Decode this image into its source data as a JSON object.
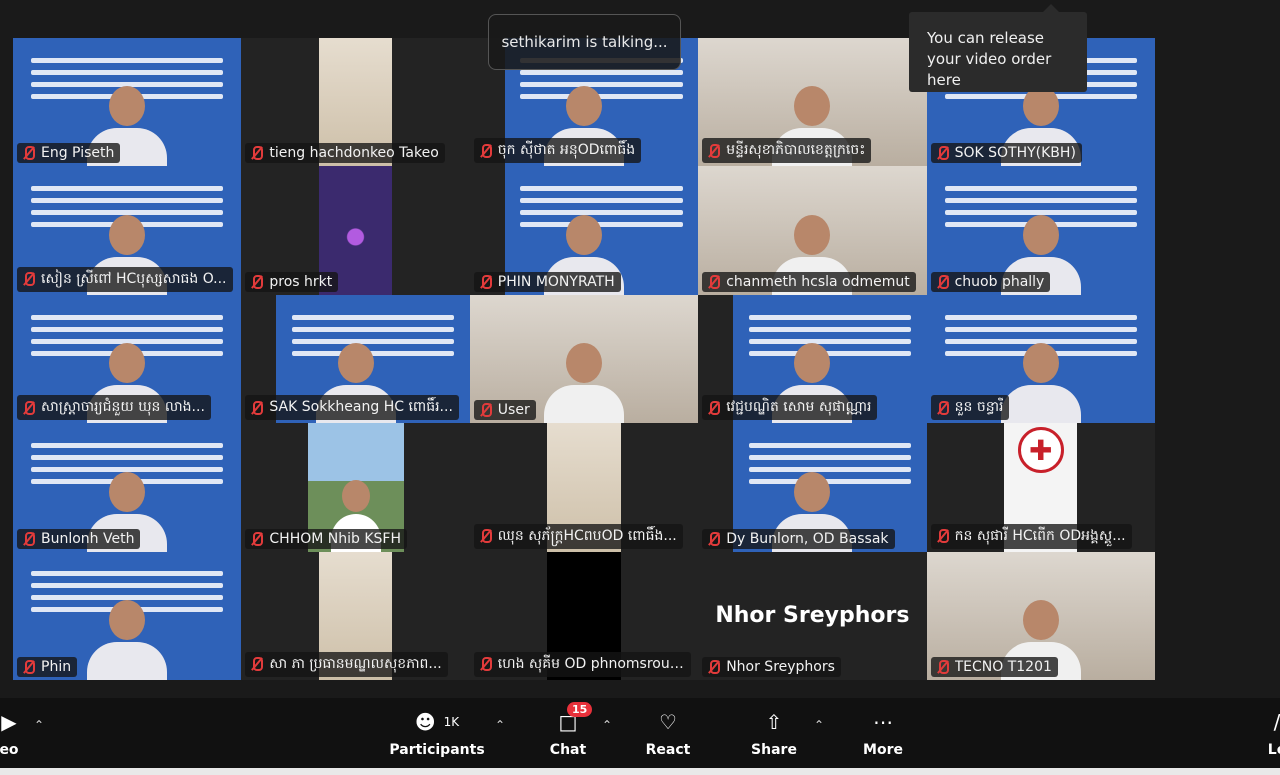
{
  "talking_indicator": "sethikarim is talking...",
  "tooltip": "You can release your video order here",
  "participants": [
    {
      "name": "Eng Piseth",
      "scene": "banner"
    },
    {
      "name": "tieng hachdonkeo Takeo",
      "scene": "ceiling"
    },
    {
      "name": "ចុក សុីថាត អនុODពោធិ៍ង",
      "scene": "banner"
    },
    {
      "name": "មន្ទីរសុខាភិបាលខេត្តក្រចេះ",
      "scene": "room"
    },
    {
      "name": "SOK SOTHY(KBH)",
      "scene": "banner"
    },
    {
      "name": "សៀន ស្រីពៅ HCបុស្សសាធង O...",
      "scene": "banner"
    },
    {
      "name": "pros hrkt",
      "scene": "dark"
    },
    {
      "name": "PHIN MONYRATH",
      "scene": "banner"
    },
    {
      "name": "chanmeth hcsla odmemut",
      "scene": "room"
    },
    {
      "name": "chuob phally",
      "scene": "banner"
    },
    {
      "name": "សាស្ត្រាចារ្យជំនួយ ឃុន លាង...",
      "scene": "banner"
    },
    {
      "name": "SAK Sokkheang HC ពោធិ៍រ...",
      "scene": "banner"
    },
    {
      "name": "User",
      "scene": "room"
    },
    {
      "name": "វេជ្ជបណ្ឌិត សោម សុផាណ្ណារ",
      "scene": "banner"
    },
    {
      "name": "នួន ចន្ធារី",
      "scene": "banner"
    },
    {
      "name": "Bunlonh Veth",
      "scene": "banner"
    },
    {
      "name": "CHHOM Nhib KSFH",
      "scene": "outdoor"
    },
    {
      "name": "ឈុន សុភ័ក្រ្តHCពបOD ពោធិ៍ង...",
      "scene": "ceiling"
    },
    {
      "name": "Dy Bunlorn, OD Bassak",
      "scene": "banner"
    },
    {
      "name": "កន សុផារី HCពើក ODអង្គស្គួ...",
      "scene": "cross"
    },
    {
      "name": "Phin",
      "scene": "banner"
    },
    {
      "name": "សា ភា ប្រធានមណ្ឌលសុខភាព...",
      "scene": "ceiling"
    },
    {
      "name": "ហេង សុគីម OD phnomsrouch",
      "scene": "black"
    },
    {
      "name": "Nhor Sreyphors",
      "scene": "nameonly"
    },
    {
      "name": "TECNO T1201",
      "scene": "room"
    }
  ],
  "nameonly_display": "Nhor Sreyphors",
  "toolbar": {
    "left_label": "eo",
    "participants_label": "Participants",
    "participants_count": "1K",
    "chat_label": "Chat",
    "chat_badge": "15",
    "react_label": "React",
    "share_label": "Share",
    "more_label": "More",
    "right_label": "Le"
  }
}
